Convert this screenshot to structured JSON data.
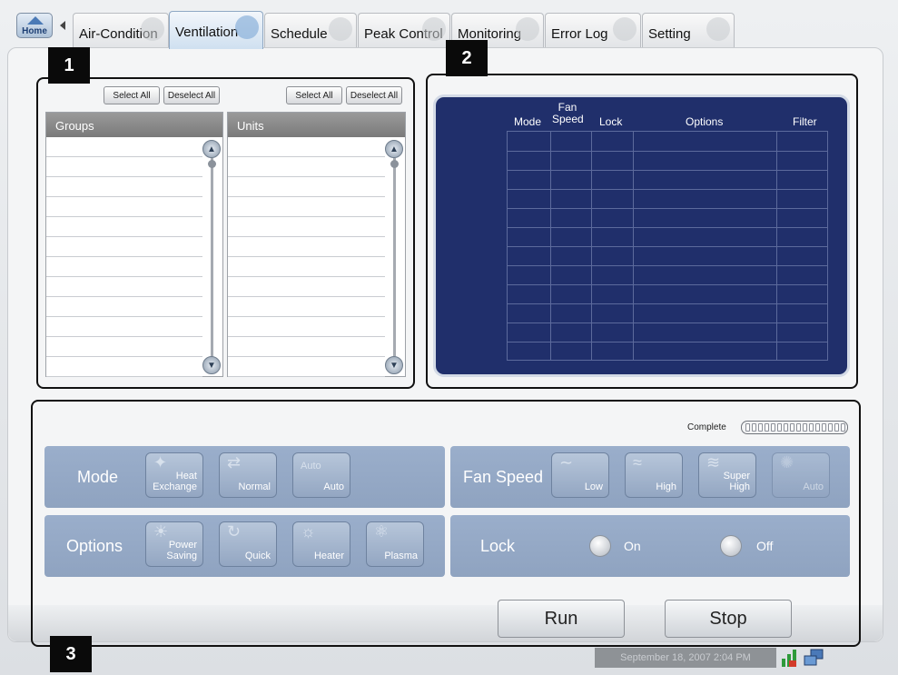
{
  "tabs": {
    "home_label": "Home",
    "items": [
      "Air-Condition",
      "Ventilation",
      "Schedule",
      "Peak Control",
      "Monitoring",
      "Error Log",
      "Setting"
    ],
    "active": "Ventilation"
  },
  "markers": [
    "1",
    "2",
    "3"
  ],
  "section1": {
    "select_all": "Select All",
    "deselect_all": "Deselect All",
    "groups_header": "Groups",
    "units_header": "Units"
  },
  "section2": {
    "columns": [
      "Mode",
      "Fan Speed",
      "Lock",
      "Options",
      "Filter"
    ],
    "col_mode": "Mode",
    "col_fan": "Fan",
    "col_speed": "Speed",
    "col_lock": "Lock",
    "col_options": "Options",
    "col_filter": "Filter"
  },
  "section3": {
    "complete_label": "Complete",
    "mode_label": "Mode",
    "mode_buttons": {
      "heat_a": "Heat",
      "heat_b": "Exchange",
      "normal": "Normal",
      "auto_top": "Auto",
      "auto": "Auto"
    },
    "fan_label": "Fan Speed",
    "fan_buttons": {
      "low": "Low",
      "high": "High",
      "super_a": "Super",
      "super_b": "High",
      "auto": "Auto"
    },
    "options_label": "Options",
    "option_buttons": {
      "power_a": "Power",
      "power_b": "Saving",
      "quick": "Quick",
      "heater": "Heater",
      "plasma": "Plasma"
    },
    "lock_label": "Lock",
    "lock_on": "On",
    "lock_off": "Off",
    "run": "Run",
    "stop": "Stop"
  },
  "statusbar": {
    "datetime": "September 18, 2007 2:04 PM"
  },
  "colors": {
    "navy_panel": "#202f6b",
    "control_bar": "#92a6c3",
    "marker": "#0a0a0a"
  }
}
